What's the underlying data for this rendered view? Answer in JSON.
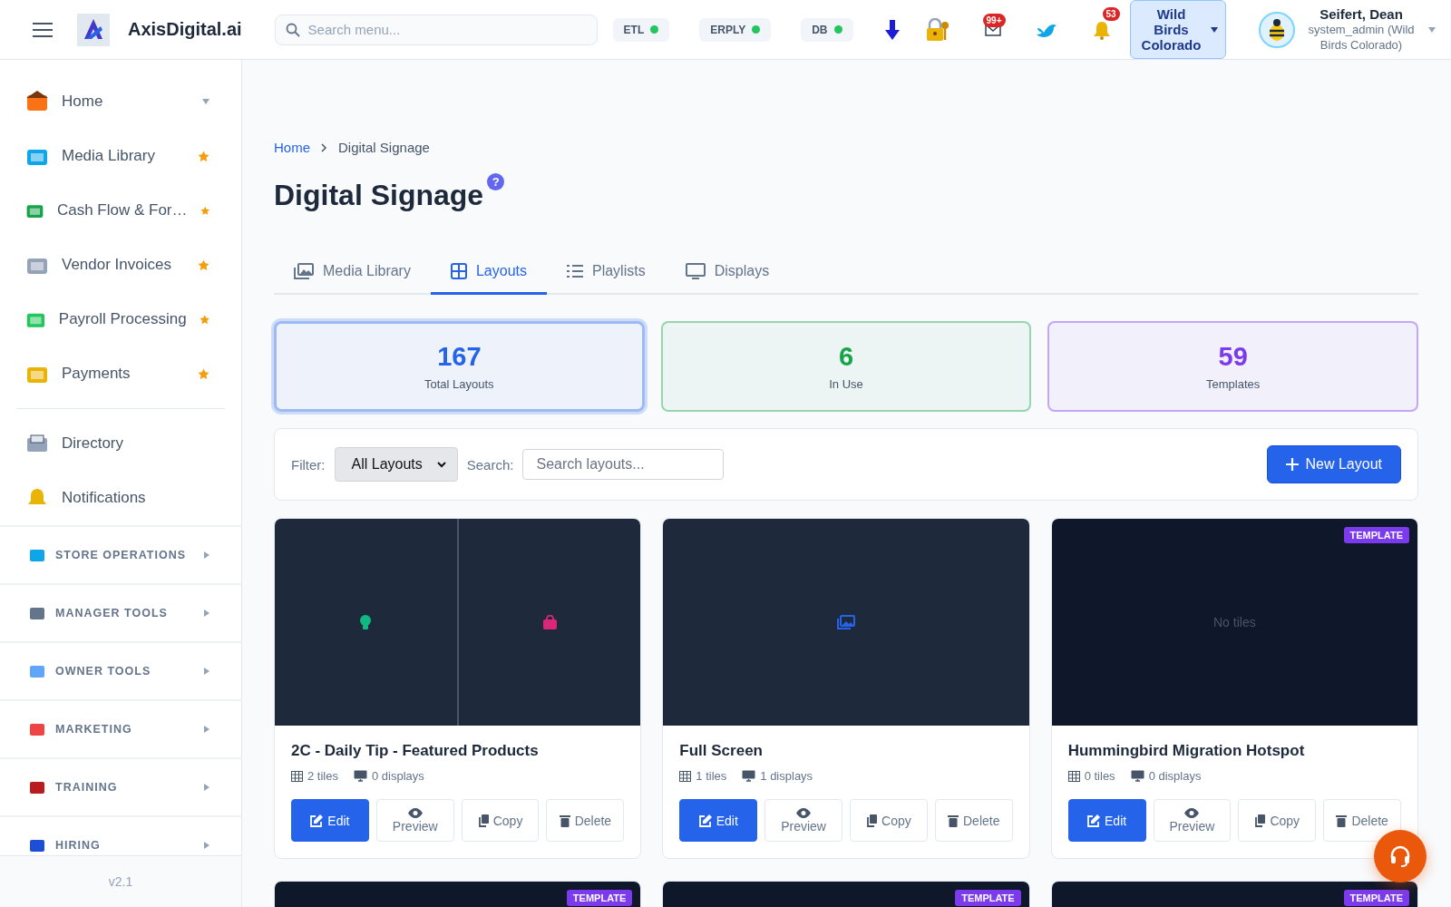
{
  "header": {
    "brand": "AxisDigital.ai",
    "search": {
      "placeholder": "Search menu..."
    },
    "status": [
      {
        "label": "ETL",
        "color": "#22c55e"
      },
      {
        "label": "ERPLY",
        "color": "#22c55e"
      },
      {
        "label": "DB",
        "color": "#22c55e"
      }
    ],
    "mail_badge": "99+",
    "bell_badge": "53",
    "store": "Wild Birds Colorado",
    "user": {
      "name": "Seifert, Dean",
      "role": "system_admin (Wild Birds Colorado)"
    }
  },
  "sidebar": {
    "items": [
      {
        "label": "Home",
        "favorite": false,
        "expandable": true
      },
      {
        "label": "Media Library",
        "favorite": true,
        "expandable": false
      },
      {
        "label": "Cash Flow & For…",
        "favorite": true,
        "expandable": false
      },
      {
        "label": "Vendor Invoices",
        "favorite": true,
        "expandable": false
      },
      {
        "label": "Payroll Processing",
        "favorite": true,
        "expandable": false
      },
      {
        "label": "Payments",
        "favorite": true,
        "expandable": false
      }
    ],
    "items2": [
      {
        "label": "Directory"
      },
      {
        "label": "Notifications"
      }
    ],
    "sections": [
      {
        "label": "STORE OPERATIONS",
        "expanded": false
      },
      {
        "label": "MANAGER TOOLS",
        "expanded": false
      },
      {
        "label": "OWNER TOOLS",
        "expanded": false
      },
      {
        "label": "MARKETING",
        "expanded": false
      },
      {
        "label": "TRAINING",
        "expanded": false
      },
      {
        "label": "HIRING",
        "expanded": false
      }
    ],
    "version": "v2.1"
  },
  "breadcrumb": [
    "Home",
    "Digital Signage"
  ],
  "title": "Digital Signage",
  "help": "?",
  "tabs": [
    {
      "label": "Media Library",
      "selected": false
    },
    {
      "label": "Layouts",
      "selected": true
    },
    {
      "label": "Playlists",
      "selected": false
    },
    {
      "label": "Displays",
      "selected": false
    }
  ],
  "stats": [
    {
      "value": "167",
      "label": "Total Layouts",
      "color": "#2563eb",
      "selected": true
    },
    {
      "value": "6",
      "label": "In Use",
      "color": "#16a34a",
      "selected": false
    },
    {
      "value": "59",
      "label": "Templates",
      "color": "#7c3aed",
      "selected": false
    }
  ],
  "filter": {
    "label": "Filter:",
    "value": "All Layouts",
    "search_label": "Search:",
    "search_placeholder": "Search layouts...",
    "new_button": "New Layout"
  },
  "layouts": [
    {
      "name": "2C - Daily Tip - Featured Products",
      "tiles": "2 tiles",
      "displays": "0 displays",
      "preview": [
        {
          "kind": "tip",
          "color": "#10b981"
        },
        {
          "kind": "product",
          "color": "#db2777"
        }
      ],
      "actions": [
        "Edit",
        "Preview",
        "Copy",
        "Delete"
      ]
    },
    {
      "name": "Full Screen",
      "tiles": "1 tiles",
      "displays": "1 displays",
      "preview": [
        {
          "kind": "media",
          "color": "#2563eb"
        }
      ],
      "actions": [
        "Edit",
        "Preview",
        "Copy",
        "Delete"
      ]
    },
    {
      "name": "Hummingbird Migration Hotspot",
      "badge": "TEMPLATE",
      "tiles": "0 tiles",
      "displays": "0 displays",
      "empty_text": "No tiles",
      "actions": [
        "Edit",
        "Preview",
        "Copy",
        "Delete"
      ]
    },
    {
      "badge": "TEMPLATE"
    },
    {
      "badge": "TEMPLATE"
    },
    {
      "badge": "TEMPLATE"
    }
  ]
}
